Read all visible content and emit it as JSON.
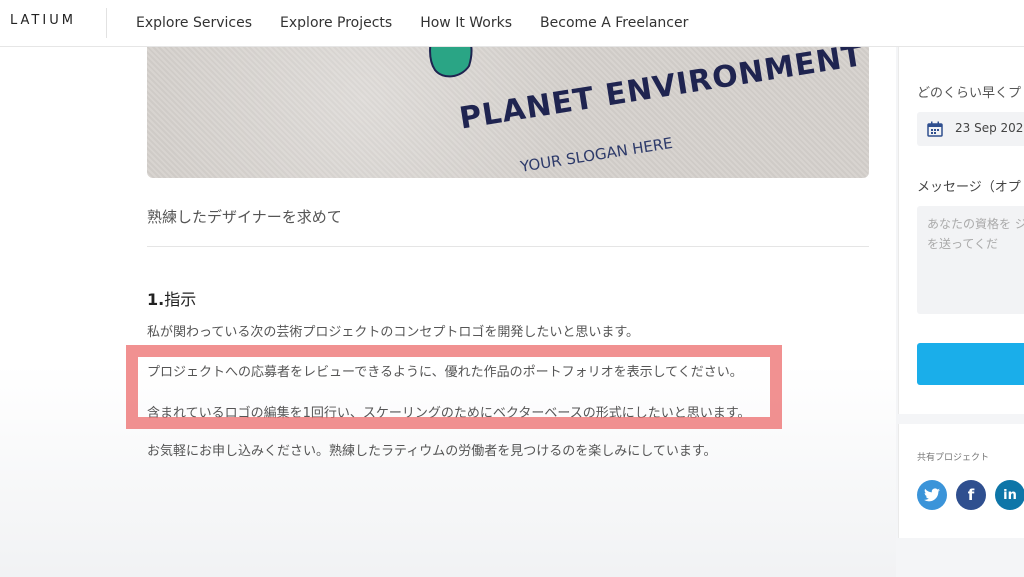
{
  "header": {
    "logo": "LATIUM",
    "nav": [
      "Explore Services",
      "Explore Projects",
      "How It Works",
      "Become A Freelancer"
    ]
  },
  "hero": {
    "title": "PLANET ENVIRONMENT",
    "slogan": "YOUR SLOGAN HERE"
  },
  "project": {
    "subtitle": "熟練したデザイナーを求めて",
    "section_num": "1.",
    "section_title": "指示",
    "paragraphs": [
      "私が関わっている次の芸術プロジェクトのコンセプトロゴを開発したいと思います。",
      "プロジェクトへの応募者をレビューできるように、優れた作品のポートフォリオを表示してください。",
      "含まれているロゴの編集を1回行い、スケーリングのためにベクターベースの形式にしたいと思います。",
      "お気軽にお申し込みください。熟練したラティウムの労働者を見つけるのを楽しみにしています。"
    ]
  },
  "sidebar": {
    "question": "どのくらい早くプ",
    "date": "23 Sep 202",
    "message_label": "メッセージ（オプ",
    "message_placeholder": "あなたの資格を ジを送ってくだ",
    "share_label": "共有プロジェクト"
  },
  "social": {
    "twitter_glyph": "🐦",
    "facebook_glyph": "f",
    "linkedin_glyph": "in"
  },
  "colors": {
    "accent": "#1aaeea",
    "highlight": "#ec6c6c",
    "twitter": "#3b94d9",
    "facebook": "#2f4f8f",
    "linkedin": "#0e76a8"
  }
}
